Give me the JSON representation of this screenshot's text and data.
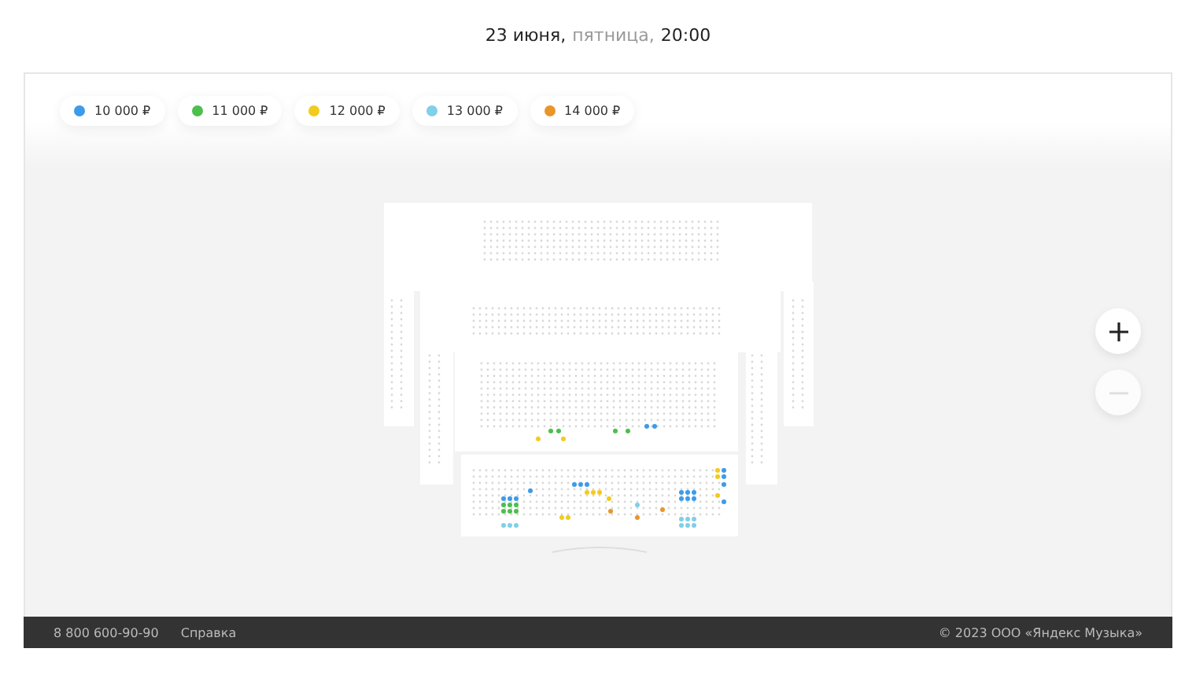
{
  "header": {
    "date": "23 июня,",
    "weekday": "пятница,",
    "time": "20:00"
  },
  "legend": [
    {
      "price": "10 000 ₽",
      "color": "#3d9be9"
    },
    {
      "price": "11 000 ₽",
      "color": "#4cbf4c"
    },
    {
      "price": "12 000 ₽",
      "color": "#f2cb1d"
    },
    {
      "price": "13 000 ₽",
      "color": "#7fd0e8"
    },
    {
      "price": "14 000 ₽",
      "color": "#e8962a"
    }
  ],
  "zoom": [
    {
      "kind": "plus",
      "disabled": false
    },
    {
      "kind": "minus",
      "disabled": true
    }
  ],
  "footer": {
    "phone": "8 800 600-90-90",
    "help": "Справка",
    "copyright": "© 2023 ООО «Яндекс Музыка»"
  }
}
